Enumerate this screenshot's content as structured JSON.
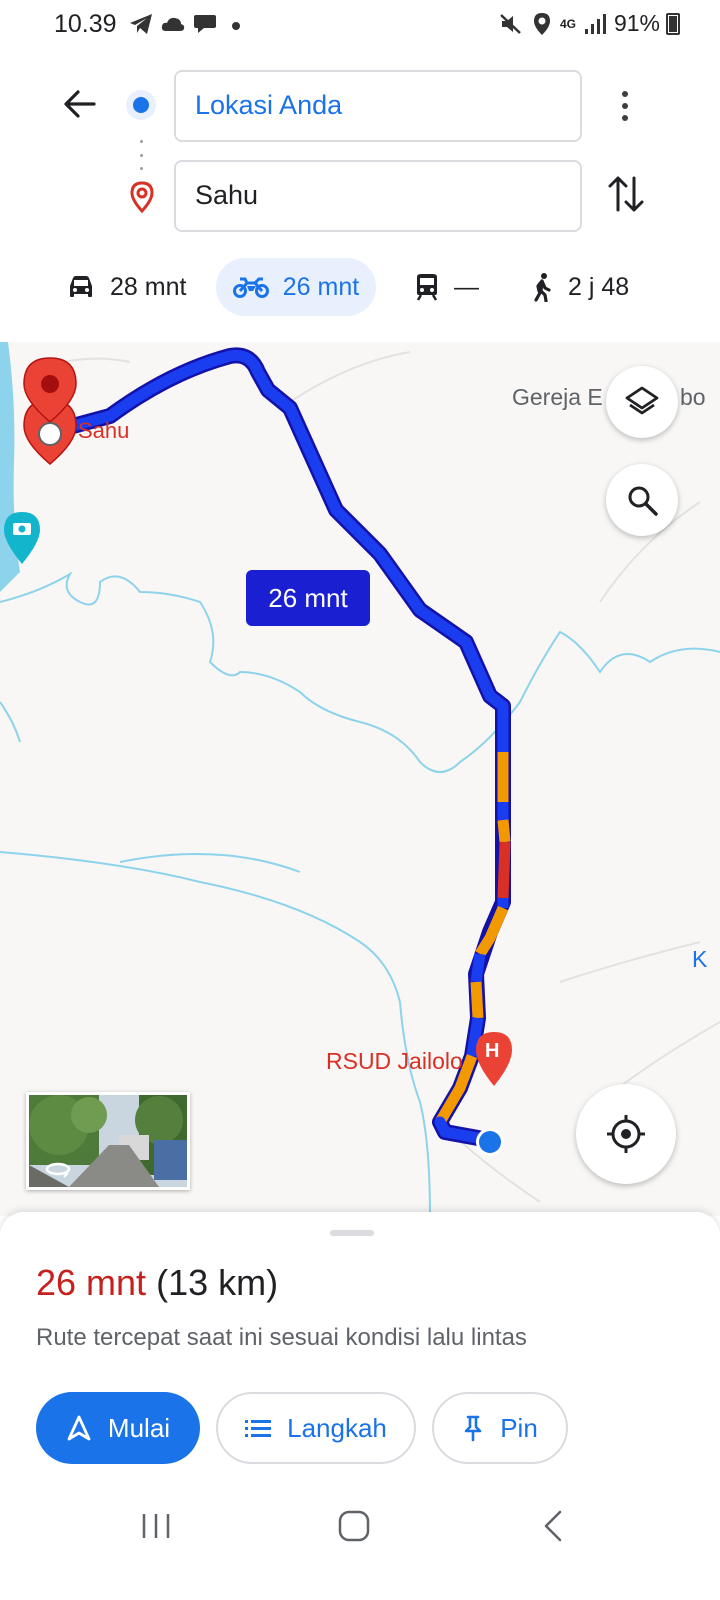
{
  "status_bar": {
    "time": "10.39",
    "battery": "91%",
    "network": "4G",
    "icons": [
      "telegram-icon",
      "cloud-icon",
      "chat-icon",
      "dot-icon",
      "mute-icon",
      "location-icon",
      "signal-icon",
      "battery-icon"
    ]
  },
  "directions": {
    "origin": "Lokasi Anda",
    "destination": "Sahu"
  },
  "modes": [
    {
      "icon": "car-icon",
      "label": "28 mnt"
    },
    {
      "icon": "motorcycle-icon",
      "label": "26 mnt",
      "selected": true
    },
    {
      "icon": "transit-icon",
      "label": "—"
    },
    {
      "icon": "walk-icon",
      "label": "2 j 48"
    }
  ],
  "map": {
    "labels": {
      "gereja": "Gereja E",
      "gereja_tail": "bo",
      "k": "K",
      "sahu": "Sahu",
      "rsud": "RSUD Jailolo",
      "hospital_letter": "H"
    },
    "eta": "26 mnt",
    "colors": {
      "route_free": "#1a3df0",
      "route_slow": "#f29900",
      "route_jam": "#d93025",
      "water": "#8ed3ec"
    }
  },
  "sheet": {
    "time": "26 mnt",
    "distance": "(13 km)",
    "description": "Rute tercepat saat ini sesuai kondisi lalu lintas",
    "buttons": {
      "start": "Mulai",
      "steps": "Langkah",
      "pin": "Pin"
    }
  },
  "colors": {
    "accent": "#1a73e8",
    "time_red": "#c5221f",
    "selected_mode_bg": "#e8f0fe"
  }
}
